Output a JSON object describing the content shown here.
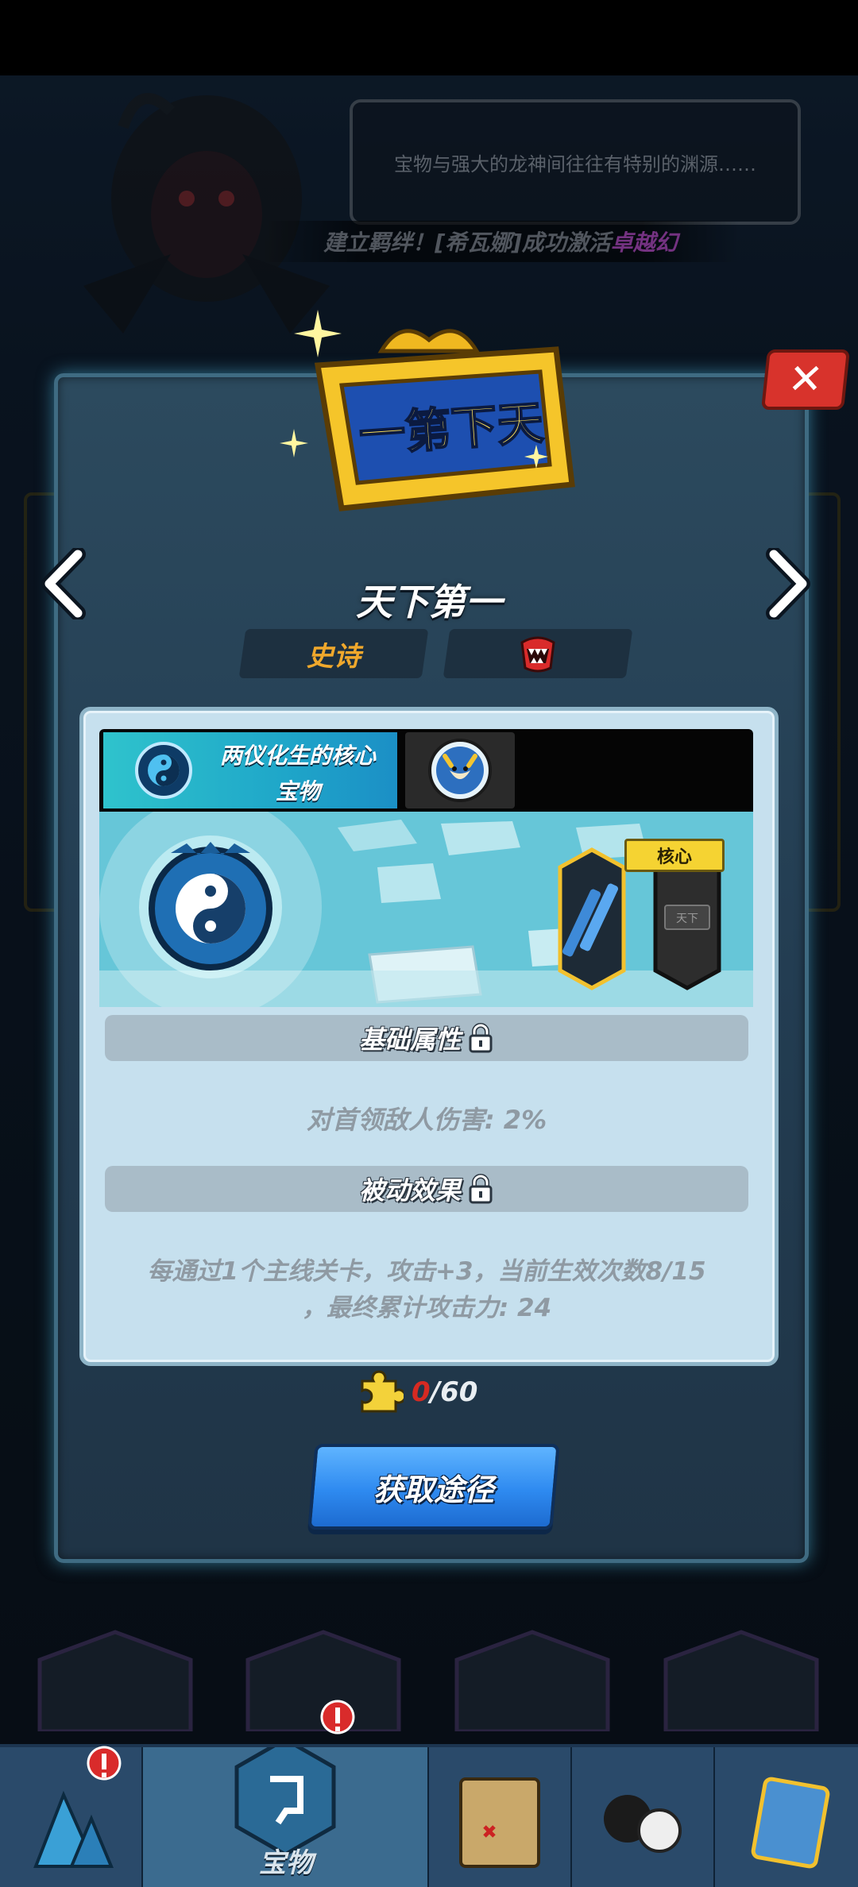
{
  "background": {
    "quote": "宝物与强大的龙神间往往有特别的渊源……",
    "notice_prefix": "建立羁绊！[希瓦娜]成功激活",
    "notice_highlight": "卓越幻"
  },
  "dialog": {
    "plaque_text": "一第下天",
    "title": "天下第一",
    "rarity": "史诗",
    "faction_icon": "demon-mouth-icon",
    "tab_primary_line1": "两仪化生的核心",
    "tab_primary_line2": "宝物",
    "core_badge": "核心",
    "base_section": "基础属性",
    "base_attr": "对首领敌人伤害: 2%",
    "passive_section": "被动效果",
    "passive_line1": "每通过1个主线关卡，攻击+3，当前生效次数8/15",
    "passive_line2": "，最终累计攻击力: 24",
    "fragments_current": "0",
    "fragments_total": "/60",
    "obtain_button": "获取途径"
  },
  "bottom_nav": {
    "active_label": "宝物"
  },
  "colors": {
    "accent_blue": "#2e8af0",
    "rarity_gold": "#f0a82c",
    "close_red": "#d8332c"
  }
}
